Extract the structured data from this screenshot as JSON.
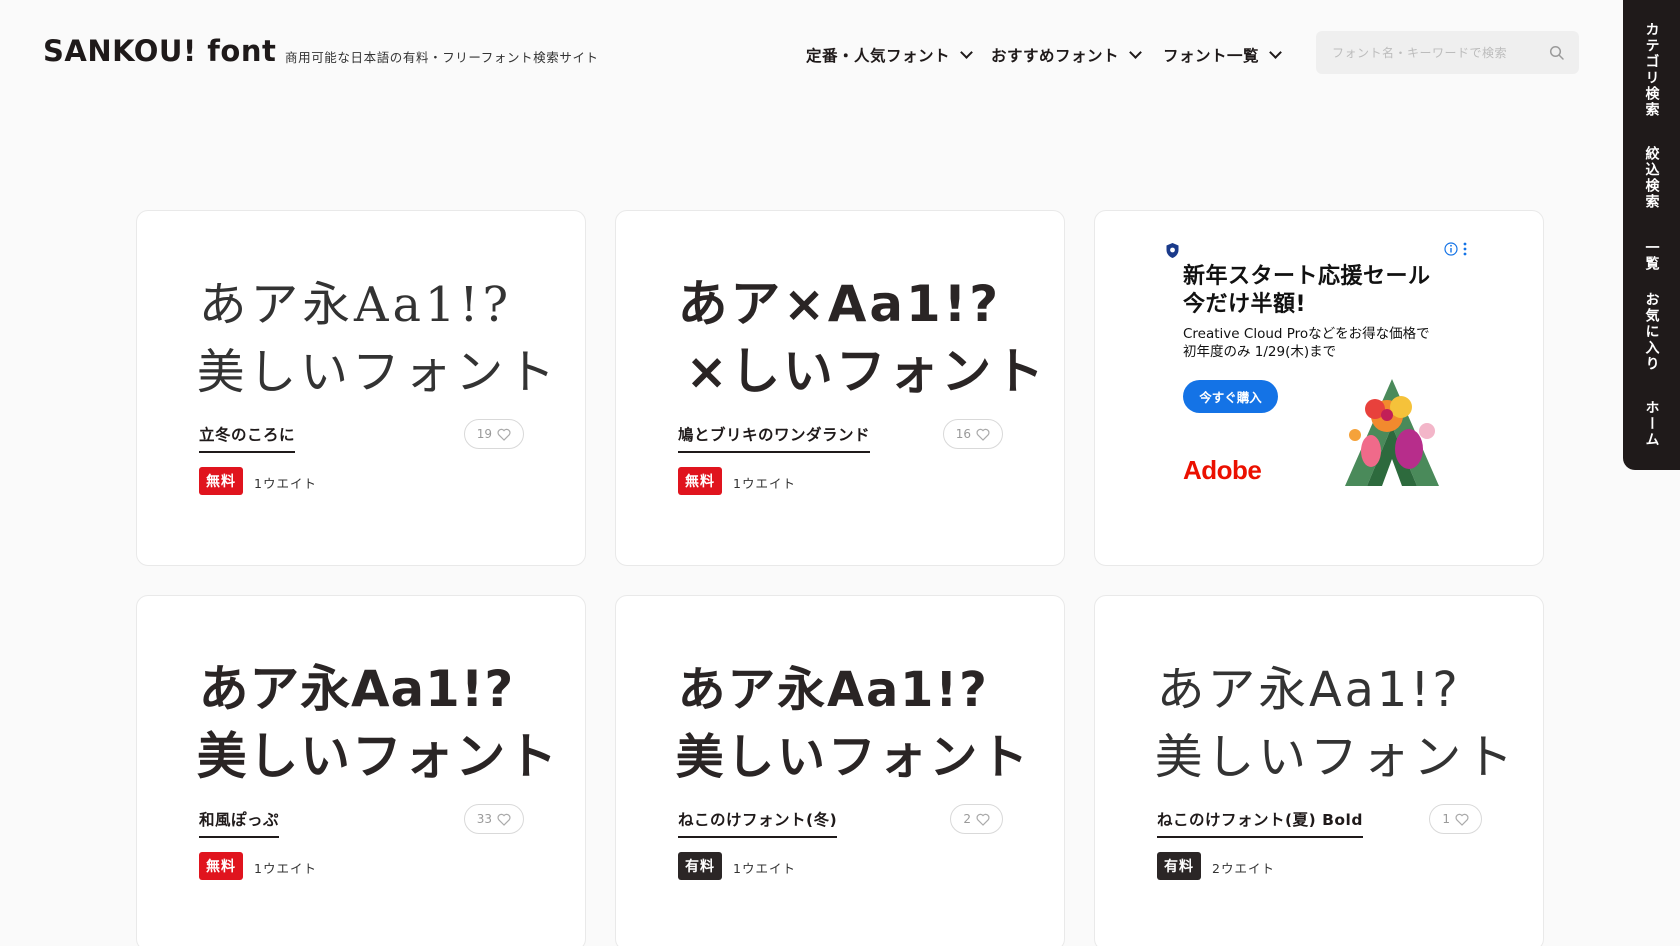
{
  "header": {
    "logo": "SANKOU! font",
    "tagline": "商用可能な日本語の有料・フリーフォント検索サイト",
    "nav": [
      {
        "label": "定番・人気フォント"
      },
      {
        "label": "おすすめフォント"
      },
      {
        "label": "フォント一覧"
      }
    ],
    "search": {
      "placeholder": "フォント名・キーワードで検索",
      "value": ""
    }
  },
  "sidetab": {
    "items": [
      {
        "label": "カテゴリ検索"
      },
      {
        "label": "絞込検索"
      },
      {
        "label": "一覧"
      },
      {
        "label": "お気に入り"
      },
      {
        "label": "ホーム"
      }
    ]
  },
  "cards": [
    {
      "name": "立冬のころに",
      "likes": "19",
      "price": "無料",
      "weights": "1ウエイト",
      "sample_line1": "あア永Aa1!?",
      "sample_line2": "美しいフォント"
    },
    {
      "name": "鳩とブリキのワンダランド",
      "likes": "16",
      "price": "無料",
      "weights": "1ウエイト",
      "sample_line1": "あア×Aa1!?",
      "sample_line2": "×しいフォント"
    },
    {
      "name": "和風ぽっぷ",
      "likes": "33",
      "price": "無料",
      "weights": "1ウエイト",
      "sample_line1": "あア永Aa1!?",
      "sample_line2": "美しいフォント"
    },
    {
      "name": "ねこのけフォント(冬)",
      "likes": "2",
      "price": "有料",
      "weights": "1ウエイト",
      "sample_line1": "あア永Aa1!?",
      "sample_line2": "美しいフォント"
    },
    {
      "name": "ねこのけフォント(夏) Bold",
      "likes": "1",
      "price": "有料",
      "weights": "2ウエイト",
      "sample_line1": "あア永Aa1!?",
      "sample_line2": "美しいフォント"
    }
  ],
  "ad": {
    "headline_1": "新年スタート応援セール",
    "headline_2": "今だけ半額!",
    "sub_1": "Creative Cloud Proなどをお得な価格で",
    "sub_2": "初年度のみ 1/29(木)まで",
    "button": "今すぐ購入",
    "brand": "Adobe"
  },
  "colors": {
    "free": "#e0141e",
    "paid": "#2b2626",
    "accent_dark": "#1f1a1a",
    "ad_blue": "#1473e6",
    "adobe_red": "#eb1000"
  }
}
